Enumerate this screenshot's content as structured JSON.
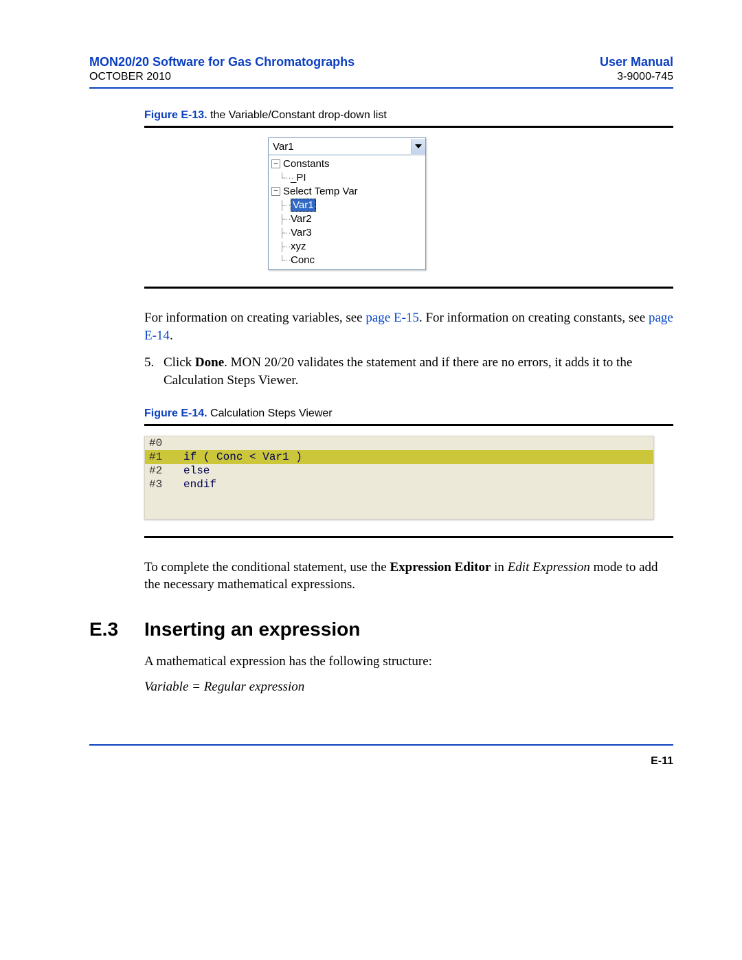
{
  "header": {
    "left": "MON20/20 Software for Gas Chromatographs",
    "right": "User Manual",
    "subleft": "OCTOBER 2010",
    "subright": "3-9000-745"
  },
  "fig13": {
    "label": "Figure E-13.",
    "caption": "  the Variable/Constant drop-down list"
  },
  "dropdown": {
    "selected": "Var1",
    "group1": "Constants",
    "g1_item1": "_PI",
    "group2": "Select Temp Var",
    "g2_item1": "Var1",
    "g2_item2": "Var2",
    "g2_item3": "Var3",
    "g2_item4": "xyz",
    "g2_item5": "Conc"
  },
  "para1a": "For information on creating variables, see ",
  "para1link1": "page E-15",
  "para1b": ".  For information on creating constants, see ",
  "para1link2": "page E-14",
  "para1c": ".",
  "step5num": "5.",
  "step5a": "Click ",
  "step5bold": "Done",
  "step5b": ".  MON 20/20 validates the statement and if there are no errors, it adds it to the Calculation Steps Viewer.",
  "fig14": {
    "label": "Figure E-14.",
    "caption": "  Calculation Steps Viewer"
  },
  "viewer": {
    "r0n": "#0",
    "r0t": "",
    "r1n": "#1",
    "r1t": "if ( Conc < Var1 )",
    "r2n": "#2",
    "r2t": "else",
    "r3n": "#3",
    "r3t": "endif"
  },
  "para2a": "To complete the conditional statement, use the ",
  "para2bold": "Expression Editor",
  "para2b": " in ",
  "para2italic": "Edit Expression",
  "para2c": " mode to add the necessary mathematical expressions.",
  "section": {
    "num": "E.3",
    "title": "Inserting an expression"
  },
  "para3": "A mathematical expression has the following structure:",
  "para4": "Variable = Regular expression",
  "pagefoot": "E-11"
}
